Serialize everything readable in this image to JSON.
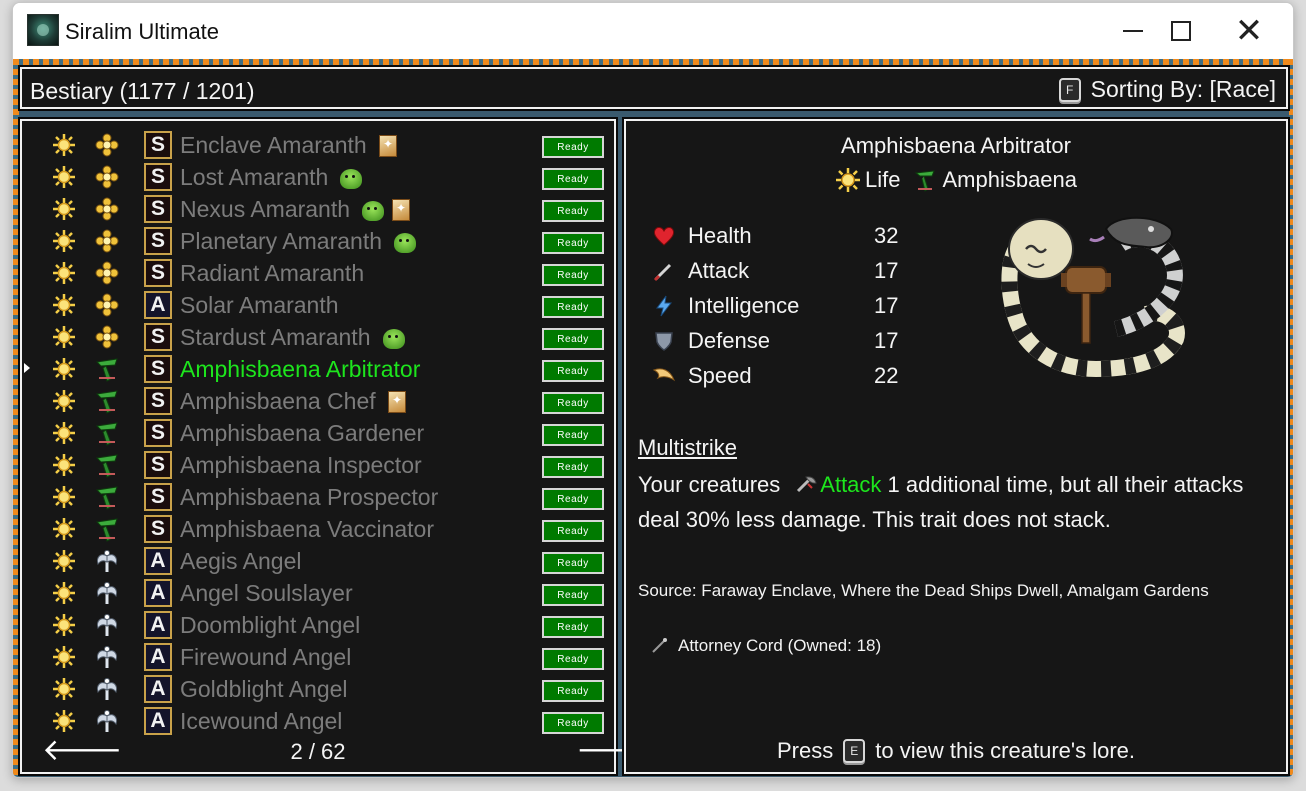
{
  "window": {
    "title": "Siralim Ultimate"
  },
  "header": {
    "title": "Bestiary (1177 / 1201)",
    "sort_key": "F",
    "sort_label": "Sorting By: [Race]"
  },
  "list": {
    "ready_label": "Ready",
    "rows": [
      {
        "name": "Enclave Amaranth",
        "card": "S",
        "race": "amaranth",
        "badges": [
          "card"
        ],
        "selected": false
      },
      {
        "name": "Lost Amaranth",
        "card": "S",
        "race": "amaranth",
        "badges": [
          "blob"
        ],
        "selected": false
      },
      {
        "name": "Nexus Amaranth",
        "card": "S",
        "race": "amaranth",
        "badges": [
          "blob",
          "card"
        ],
        "selected": false
      },
      {
        "name": "Planetary Amaranth",
        "card": "S",
        "race": "amaranth",
        "badges": [
          "blob"
        ],
        "selected": false
      },
      {
        "name": "Radiant Amaranth",
        "card": "S",
        "race": "amaranth",
        "badges": [],
        "selected": false
      },
      {
        "name": "Solar Amaranth",
        "card": "A",
        "race": "amaranth",
        "badges": [],
        "selected": false
      },
      {
        "name": "Stardust Amaranth",
        "card": "S",
        "race": "amaranth",
        "badges": [
          "blob"
        ],
        "selected": false
      },
      {
        "name": "Amphisbaena Arbitrator",
        "card": "S",
        "race": "amphisbaena",
        "badges": [],
        "selected": true
      },
      {
        "name": "Amphisbaena Chef",
        "card": "S",
        "race": "amphisbaena",
        "badges": [
          "card"
        ],
        "selected": false
      },
      {
        "name": "Amphisbaena Gardener",
        "card": "S",
        "race": "amphisbaena",
        "badges": [],
        "selected": false
      },
      {
        "name": "Amphisbaena Inspector",
        "card": "S",
        "race": "amphisbaena",
        "badges": [],
        "selected": false
      },
      {
        "name": "Amphisbaena Prospector",
        "card": "S",
        "race": "amphisbaena",
        "badges": [],
        "selected": false
      },
      {
        "name": "Amphisbaena Vaccinator",
        "card": "S",
        "race": "amphisbaena",
        "badges": [],
        "selected": false
      },
      {
        "name": "Aegis Angel",
        "card": "A",
        "race": "angel",
        "badges": [],
        "selected": false
      },
      {
        "name": "Angel Soulslayer",
        "card": "A",
        "race": "angel",
        "badges": [],
        "selected": false
      },
      {
        "name": "Doomblight Angel",
        "card": "A",
        "race": "angel",
        "badges": [],
        "selected": false
      },
      {
        "name": "Firewound Angel",
        "card": "A",
        "race": "angel",
        "badges": [],
        "selected": false
      },
      {
        "name": "Goldblight Angel",
        "card": "A",
        "race": "angel",
        "badges": [],
        "selected": false
      },
      {
        "name": "Icewound Angel",
        "card": "A",
        "race": "angel",
        "badges": [],
        "selected": false
      }
    ]
  },
  "pager": {
    "current": "2 / 62"
  },
  "detail": {
    "name": "Amphisbaena Arbitrator",
    "class_label": "Life",
    "race_label": "Amphisbaena",
    "stats": [
      {
        "label": "Health",
        "value": "32",
        "icon": "heart-icon"
      },
      {
        "label": "Attack",
        "value": "17",
        "icon": "sword-icon"
      },
      {
        "label": "Intelligence",
        "value": "17",
        "icon": "lightning-icon"
      },
      {
        "label": "Defense",
        "value": "17",
        "icon": "shield-icon"
      },
      {
        "label": "Speed",
        "value": "22",
        "icon": "wing-icon"
      }
    ],
    "trait_name": "Multistrike",
    "trait_part1": "Your creatures",
    "trait_keyword": "Attack",
    "trait_part2": "1 additional time, but all their attacks deal 30% less damage. This trait does not stack.",
    "source": "Source: Faraway Enclave, Where the Dead Ships Dwell, Amalgam Gardens",
    "material": "Attorney Cord (Owned: 18)",
    "press_prefix": "Press",
    "press_key": "E",
    "press_suffix": "to view this creature's lore."
  }
}
